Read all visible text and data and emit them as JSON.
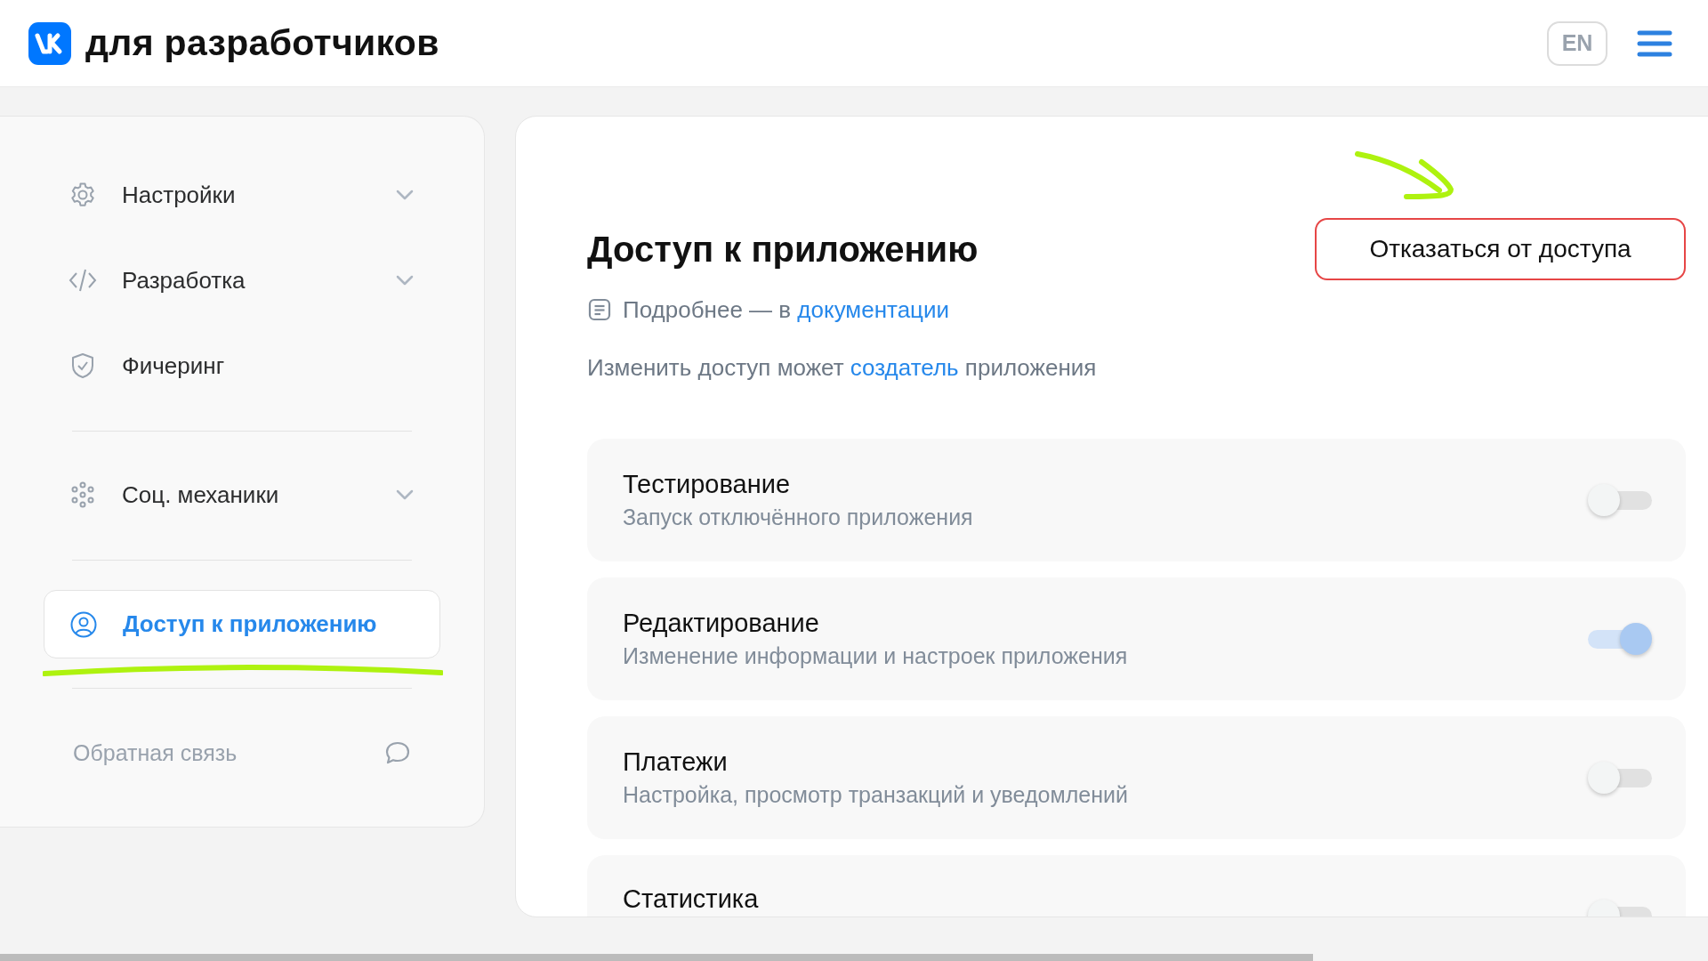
{
  "header": {
    "title": "для разработчиков",
    "language_button": "EN"
  },
  "sidebar": {
    "sections": [
      {
        "items": [
          {
            "label": "Настройки",
            "expandable": true,
            "selected": false
          },
          {
            "label": "Разработка",
            "expandable": true,
            "selected": false
          },
          {
            "label": "Фичеринг",
            "expandable": false,
            "selected": false
          }
        ]
      },
      {
        "items": [
          {
            "label": "Соц. механики",
            "expandable": true,
            "selected": false
          }
        ]
      },
      {
        "items": [
          {
            "label": "Доступ к приложению",
            "expandable": false,
            "selected": true
          }
        ]
      }
    ],
    "feedback": "Обратная связь"
  },
  "main": {
    "title": "Доступ к приложению",
    "revoke_button": "Отказаться от доступа",
    "docs_note": {
      "text": "Подробнее — в",
      "link": "документации"
    },
    "permission_note": {
      "before": "Изменить доступ может",
      "link": "создатель",
      "after": "приложения"
    },
    "permissions": [
      {
        "title": "Тестирование",
        "description": "Запуск отключённого приложения",
        "on": false
      },
      {
        "title": "Редактирование",
        "description": "Изменение информации и настроек приложения",
        "on": true
      },
      {
        "title": "Платежи",
        "description": "Настройка, просмотр транзакций и уведомлений",
        "on": false
      },
      {
        "title": "Статистика",
        "on": false
      }
    ]
  }
}
